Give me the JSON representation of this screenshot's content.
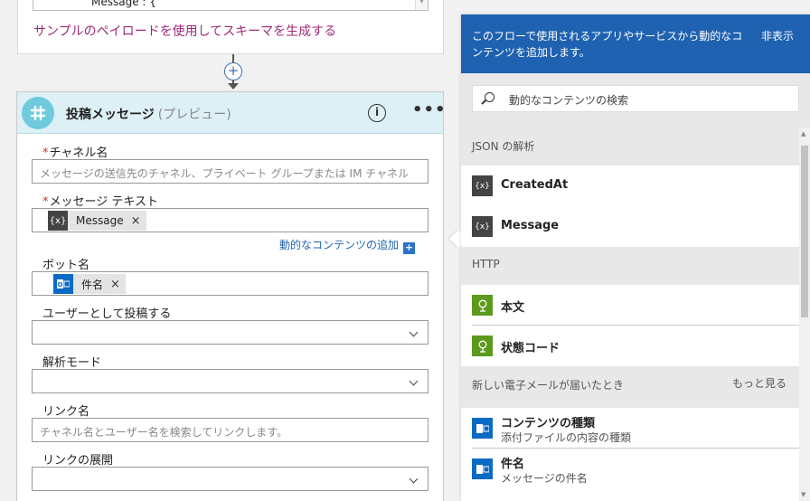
{
  "previous_step": {
    "input_value": "Message : {",
    "generate_link": "サンプルのペイロードを使用してスキーマを生成する"
  },
  "card": {
    "title": "投稿メッセージ",
    "subtitle": "(プレビュー)",
    "info_glyph": "i",
    "more_glyph": "•••",
    "fields": {
      "channel": {
        "label": "チャネル名",
        "required": "*",
        "placeholder": "メッセージの送信先のチャネル、プライベート グループまたは IM チャネル"
      },
      "message_text": {
        "label": "メッセージ テキスト",
        "required": "*",
        "token": {
          "text": "Message",
          "icon": "{x}",
          "remove": "×"
        }
      },
      "add_dynamic": "動的なコンテンツの追加",
      "bot_name": {
        "label": "ボット名",
        "token": {
          "text": "件名",
          "icon": "O",
          "remove": "×"
        }
      },
      "post_as_user": {
        "label": "ユーザーとして投稿する",
        "value": ""
      },
      "parse_mode": {
        "label": "解析モード",
        "value": ""
      },
      "link_names": {
        "label": "リンク名",
        "placeholder": "チャネル名とユーザー名を検索してリンクします。"
      },
      "unfurl_links": {
        "label": "リンクの展開",
        "value": ""
      }
    }
  },
  "panel": {
    "description": "このフローで使用されるアプリやサービスから動的なコンテンツを追加します。",
    "hide_label": "非表示",
    "search_placeholder": "動的なコンテンツの検索",
    "sections": [
      {
        "title": "JSON の解析",
        "items": [
          {
            "label": "CreatedAt",
            "icon": "{x}",
            "icon_color": "#444444"
          },
          {
            "label": "Message",
            "icon": "{x}",
            "icon_color": "#444444"
          }
        ]
      },
      {
        "title": "HTTP",
        "items": [
          {
            "label": "本文",
            "icon": "globe-icon",
            "icon_color": "#5c9a1b"
          },
          {
            "label": "状態コード",
            "icon": "globe-icon",
            "icon_color": "#5c9a1b"
          }
        ]
      },
      {
        "title": "新しい電子メールが届いたとき",
        "more": "もっと見る",
        "items": [
          {
            "label": "コンテンツの種類",
            "sub": "添付ファイルの内容の種類",
            "icon": "outlook-icon",
            "icon_color": "#0b6ac4"
          },
          {
            "label": "件名",
            "sub": "メッセージの件名",
            "icon": "outlook-icon",
            "icon_color": "#0b6ac4"
          }
        ]
      }
    ]
  },
  "colors": {
    "panel_header": "#1f62b1",
    "card_header": "#ddf0f5",
    "slack_logo": "#6ecadc",
    "link": "#2067b0",
    "generate_link": "#9e2b78"
  }
}
